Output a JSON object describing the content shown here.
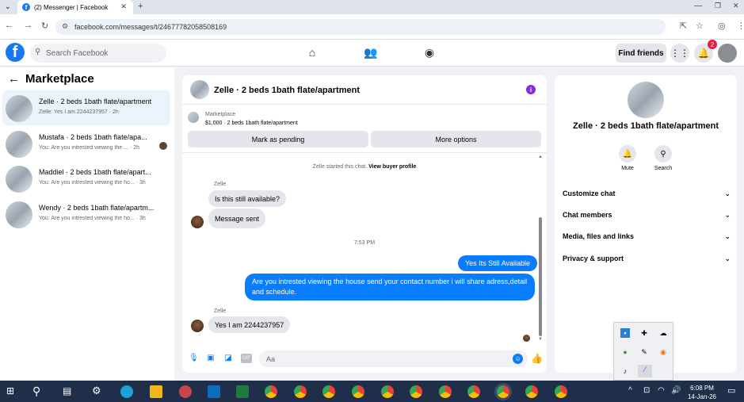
{
  "browser": {
    "tab_title": "(2) Messenger | Facebook",
    "url": "facebook.com/messages/t/24677782058508169"
  },
  "header": {
    "search_placeholder": "Search Facebook",
    "find_friends": "Find friends",
    "notification_count": "2"
  },
  "left_panel": {
    "title": "Marketplace",
    "conversations": [
      {
        "title": "Zelle · 2 beds 1bath flate/apartment",
        "preview": "Zelle: Yes I am 2244237957 · 2h"
      },
      {
        "title": "Mustafa · 2 beds 1bath flate/apa...",
        "preview": "You: Are you intrested viewing the ... · 2h"
      },
      {
        "title": "Maddiel · 2 beds 1bath flate/apart...",
        "preview": "You: Are you intrested viewing the ho... · 3h"
      },
      {
        "title": "Wendy · 2 beds 1bath flate/apartm...",
        "preview": "You: Are you intrested viewing the ho... · 3h"
      }
    ]
  },
  "chat": {
    "title": "Zelle · 2 beds 1bath flate/apartment",
    "marketplace_label": "Marketplace",
    "listing": "$1,000 · 2 beds 1bath flate/apartment",
    "mark_pending": "Mark as pending",
    "more_options": "More options",
    "started_text": "Zelle started this chat.",
    "view_profile": "View buyer profile",
    "sender1": "Zelle",
    "msg1": "Is this still available?",
    "msg2": "Message sent",
    "time": "7:53 PM",
    "msg3": "Yes Its Still Available",
    "msg4": "Are you intrested viewing the house send your contact number i will share adress,detail and schedule.",
    "sender2": "Zelle",
    "msg5": "Yes I am 2244237957",
    "input_placeholder": "Aa"
  },
  "right_panel": {
    "name": "Zelle · 2 beds 1bath flate/apartment",
    "mute": "Mute",
    "search": "Search",
    "sections": [
      "Customize chat",
      "Chat members",
      "Media, files and links",
      "Privacy & support"
    ]
  },
  "taskbar": {
    "time": "6:08 PM",
    "date": "14-Jan-26"
  }
}
